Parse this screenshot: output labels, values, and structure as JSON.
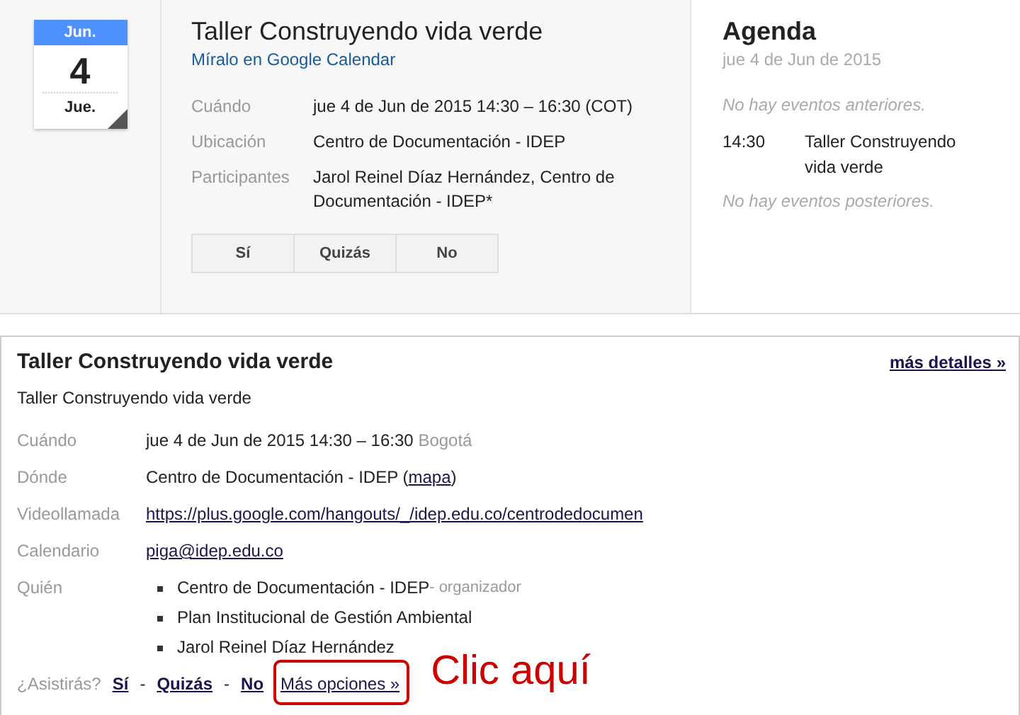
{
  "invite": {
    "calendar_badge": {
      "month": "Jun.",
      "day": "4",
      "weekday": "Jue."
    },
    "title": "Taller Construyendo vida verde",
    "calendar_link": "Míralo en Google Calendar",
    "details": [
      {
        "label": "Cuándo",
        "value": "jue 4 de Jun de 2015 14:30 – 16:30 (COT)"
      },
      {
        "label": "Ubicación",
        "value": "Centro de Documentación - IDEP"
      },
      {
        "label": "Participantes",
        "value": "Jarol Reinel Díaz Hernández, Centro de Documentación - IDEP*"
      }
    ],
    "rsvp_buttons": [
      "Sí",
      "Quizás",
      "No"
    ]
  },
  "agenda": {
    "title": "Agenda",
    "date": "jue 4 de Jun de 2015",
    "before": "No hay eventos anteriores.",
    "events": [
      {
        "time": "14:30",
        "title": "Taller Construyendo vida verde"
      }
    ],
    "after": "No hay eventos posteriores."
  },
  "event": {
    "title": "Taller Construyendo vida verde",
    "more_details": "más detalles »",
    "description": "Taller Construyendo vida verde",
    "rows": [
      {
        "kind": "text",
        "label": "Cuándo",
        "value": "jue 4 de Jun de 2015 14:30 – 16:30",
        "note": "Bogotá"
      },
      {
        "kind": "place",
        "label": "Dónde",
        "value": "Centro de Documentación - IDEP",
        "link": "mapa",
        "open": "(",
        "close": ")"
      },
      {
        "kind": "link",
        "label": "Videollamada",
        "value": "https://plus.google.com/hangouts/_/idep.edu.co/centrodedocumen"
      },
      {
        "kind": "link",
        "label": "Calendario",
        "value": "piga@idep.edu.co"
      },
      {
        "kind": "people",
        "label": "Quién",
        "people": [
          {
            "name": "Centro de Documentación - IDEP",
            "role": "- organizador"
          },
          {
            "name": "Plan Institucional de Gestión Ambiental"
          },
          {
            "name": "Jarol Reinel Díaz Hernández"
          }
        ]
      }
    ],
    "rsvp": {
      "label": "¿Asistirás?",
      "options": [
        "Sí",
        "Quizás",
        "No"
      ],
      "separator": "-",
      "more": "Más opciones »"
    },
    "annotation": "Clic aquí"
  }
}
